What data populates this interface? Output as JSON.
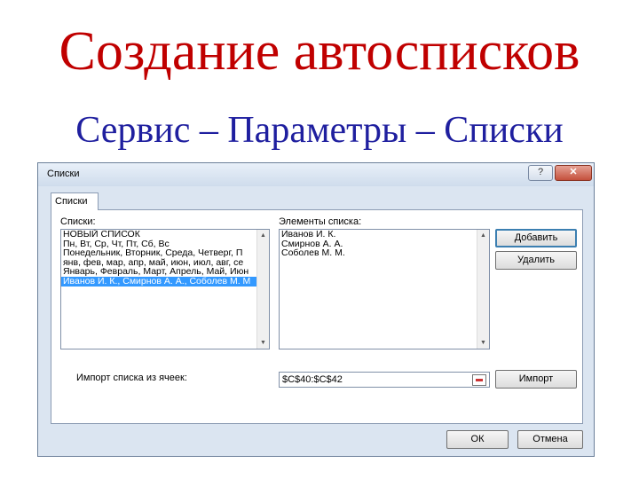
{
  "slide": {
    "title": "Создание автосписков",
    "title_color": "#c00000",
    "subtitle": "Сервис – Параметры – Списки",
    "subtitle_color": "#1f1f9f"
  },
  "dialog": {
    "title": "Списки",
    "help_label": "?",
    "close_label": "✕",
    "tab_label": "Списки",
    "lists_label": "Списки:",
    "lists": [
      "НОВЫЙ СПИСОК",
      "Пн, Вт, Ср, Чт, Пт, Сб, Вс",
      "Понедельник, Вторник, Среда, Четверг, П",
      "янв, фев, мар, апр, май, июн, июл, авг, се",
      "Январь, Февраль, Март, Апрель, Май, Июн",
      "Иванов И. К., Смирнов А. А., Соболев М. М"
    ],
    "selected_list_index": 5,
    "entries_label": "Элементы списка:",
    "entries": [
      "Иванов И. К.",
      "Смирнов А. А.",
      "Соболев М. М."
    ],
    "add_button": "Добавить",
    "delete_button": "Удалить",
    "import_label": "Импорт списка из ячеек:",
    "import_value": "$C$40:$C$42",
    "import_button": "Импорт",
    "ok_button": "ОК",
    "cancel_button": "Отмена",
    "scroll_up_icon": "▲",
    "scroll_down_icon": "▼",
    "selection_color": "#3399ff"
  }
}
